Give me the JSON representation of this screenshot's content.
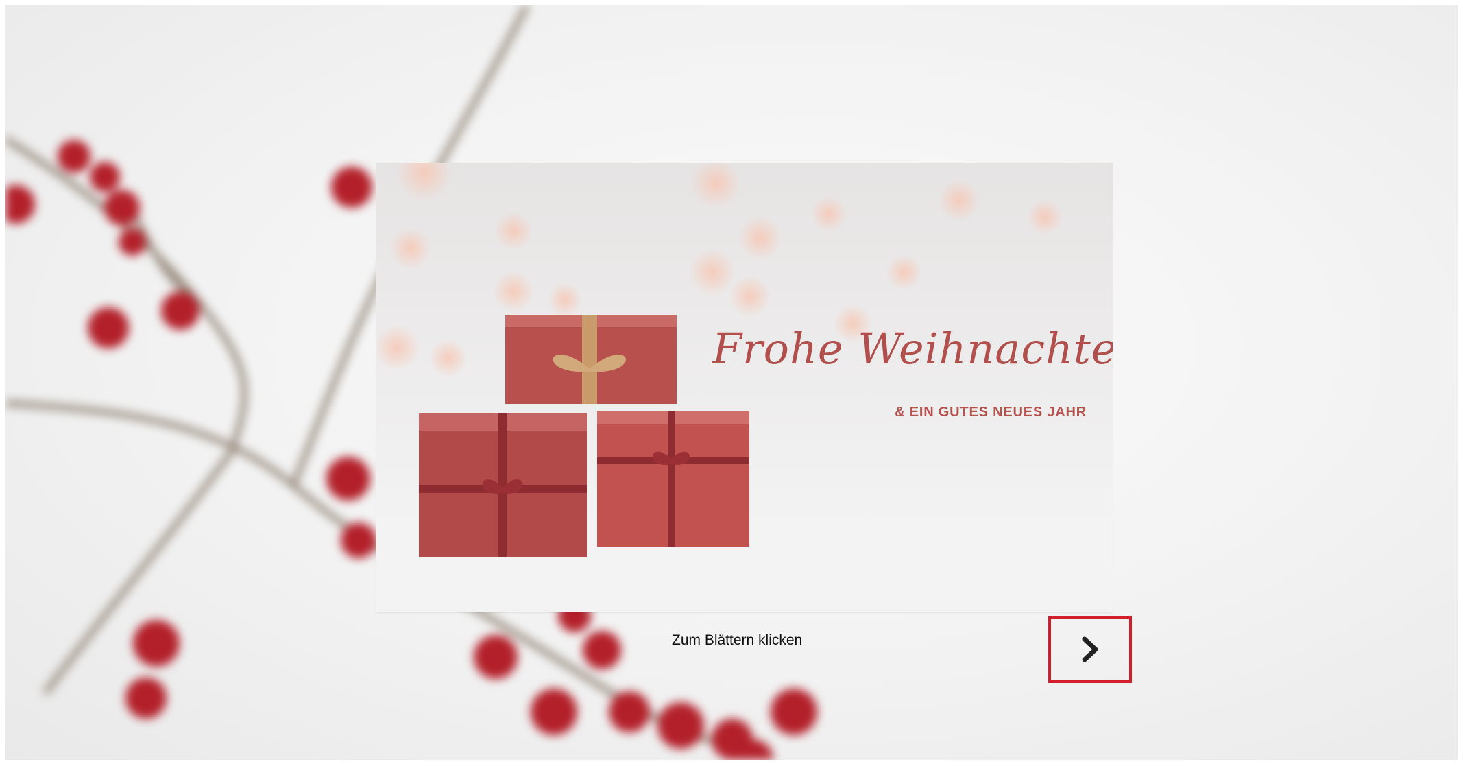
{
  "card": {
    "headline": "Frohe Weihnachten",
    "subline": "& EIN GUTES NEUES JAHR"
  },
  "navigation": {
    "hint": "Zum Blättern klicken",
    "next_icon": "chevron-right-icon"
  },
  "colors": {
    "accent_red": "#d21e2b",
    "headline_red": "#b04f4c",
    "gift_red": "#b8504d",
    "berry_red": "#b3202a"
  }
}
